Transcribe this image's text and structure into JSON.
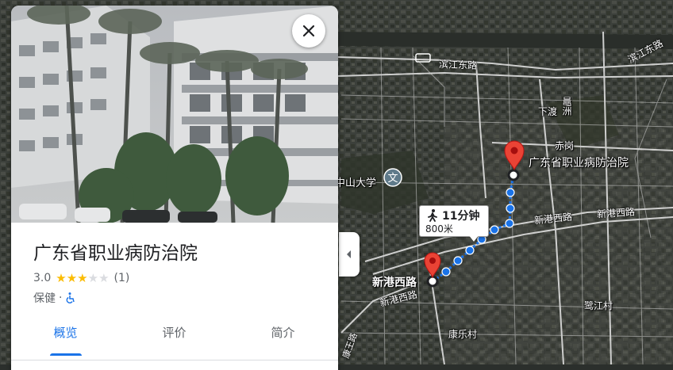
{
  "place": {
    "name": "广东省职业病防治院",
    "rating": "3.0",
    "rating_value": 3.0,
    "review_count": "(1)",
    "category": "保健",
    "separator": "·",
    "accessibility_icon": "wheelchair-icon"
  },
  "tabs": [
    {
      "label": "概览",
      "active": true
    },
    {
      "label": "评价",
      "active": false
    },
    {
      "label": "简介",
      "active": false
    }
  ],
  "route": {
    "mode_icon": "walking-icon",
    "duration": "11分钟",
    "distance": "800米",
    "color": "#1a73e8"
  },
  "map": {
    "destination_label": "广东省职业病防治院",
    "origin_label": "新港西路",
    "pin_color": "#ea4335",
    "labels": {
      "binjiang_east_road": "滨江东路",
      "binjiang_east_road_2": "滨江东路",
      "xiadu": "下渡",
      "guanzhou": "鼂洲",
      "chigang": "赤岗",
      "sun_yat_sen_univ": "中山大学",
      "xingang_west_road_1": "新港西路",
      "xingang_west_road_2": "新港西路",
      "xingang_west_road_3": "新港西路",
      "lujiang_village": "鹭江村",
      "kangle_village": "康乐村",
      "kangle_road": "康王路"
    }
  },
  "colors": {
    "accent": "#1a73e8",
    "star": "#fbbc04",
    "star_empty": "#dadce0"
  }
}
